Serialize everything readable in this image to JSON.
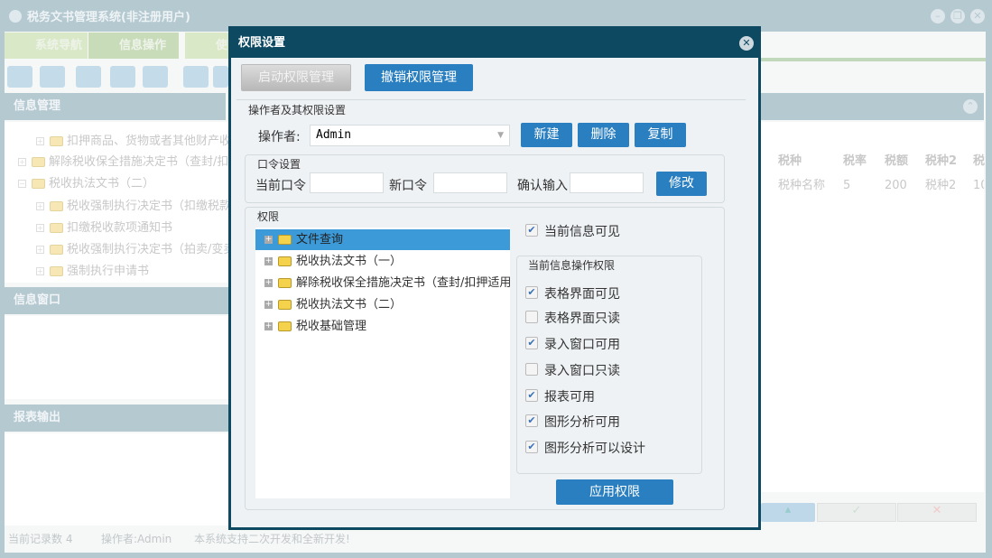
{
  "app": {
    "title": "税务文书管理系统(非注册用户)"
  },
  "tabs": [
    {
      "label": "系统导航"
    },
    {
      "label": "信息操作"
    },
    {
      "label": "使"
    }
  ],
  "left": {
    "panel1": "信息管理",
    "panel2": "信息窗口",
    "panel3": "报表输出",
    "tree": [
      "扣押商品、货物或者其他财产收",
      "解除税收保全措施决定书（查封/扣",
      "税收执法文书（二）",
      "税收强制执行决定书（扣缴税款",
      "扣缴税收款项通知书",
      "税收强制执行决定书（拍卖/变卖",
      "强制执行申请书"
    ]
  },
  "table": {
    "headers": [
      "税种",
      "税率",
      "税额",
      "税种2",
      "税"
    ],
    "row": [
      "税种名称",
      "5",
      "200",
      "税种2",
      "10"
    ]
  },
  "status": {
    "records": "当前记录数 4",
    "operator": "操作者:Admin",
    "note": "本系统支持二次开发和全新开发!"
  },
  "dialog": {
    "title": "权限设置",
    "enable_btn": "启动权限管理",
    "revoke_btn": "撤销权限管理",
    "operator_group": "操作者及其权限设置",
    "operator_label": "操作者:",
    "operator_value": "Admin",
    "new_btn": "新建",
    "delete_btn": "删除",
    "copy_btn": "复制",
    "password_group": "口令设置",
    "current_pw": "当前口令",
    "new_pw": "新口令",
    "confirm_pw": "确认输入",
    "modify_btn": "修改",
    "perm_group": "权限",
    "tree": [
      {
        "label": "文件查询",
        "selected": true
      },
      {
        "label": "税收执法文书（一）"
      },
      {
        "label": "解除税收保全措施决定书（查封/扣押适用"
      },
      {
        "label": "税收执法文书（二）"
      },
      {
        "label": "税收基础管理"
      }
    ],
    "visible_label": "当前信息可见",
    "visible_checked": true,
    "ops_group": "当前信息操作权限",
    "ops": [
      {
        "label": "表格界面可见",
        "checked": true
      },
      {
        "label": "表格界面只读",
        "checked": false
      },
      {
        "label": "录入窗口可用",
        "checked": true
      },
      {
        "label": "录入窗口只读",
        "checked": false
      },
      {
        "label": "报表可用",
        "checked": true
      },
      {
        "label": "图形分析可用",
        "checked": true
      },
      {
        "label": "图形分析可以设计",
        "checked": true
      }
    ],
    "apply_btn": "应用权限"
  },
  "colors": {
    "dialog_border": "#0d4a62",
    "accent": "#2a7fc1",
    "selection": "#3d9ad9"
  }
}
